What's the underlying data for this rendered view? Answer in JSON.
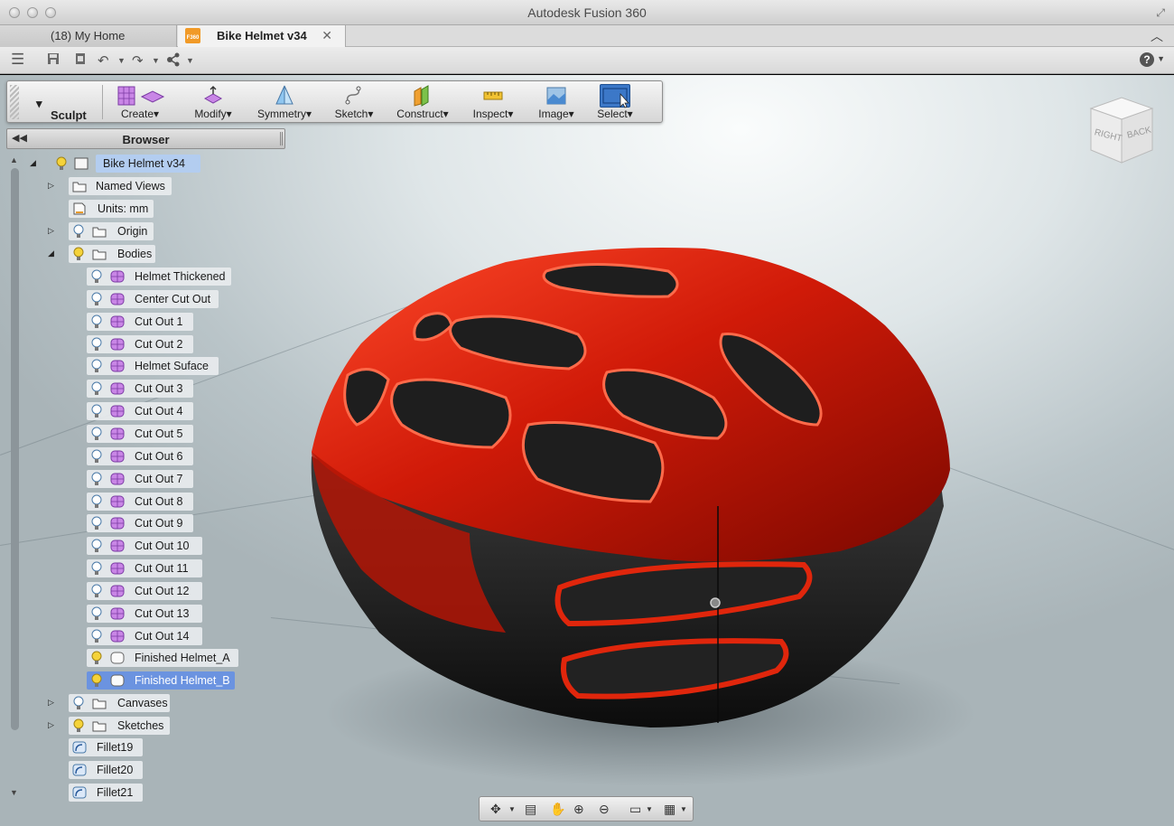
{
  "window": {
    "title": "Autodesk Fusion 360"
  },
  "tabs": [
    {
      "label": "(18) My Home"
    },
    {
      "label": "Bike Helmet v34",
      "icon_text": "F360"
    }
  ],
  "toolbar": {
    "workspace": "Sculpt",
    "tools": [
      {
        "label": "Create",
        "icon": "box-plane-icon"
      },
      {
        "label": "Modify",
        "icon": "modify-icon"
      },
      {
        "label": "Symmetry",
        "icon": "symmetry-icon"
      },
      {
        "label": "Sketch",
        "icon": "sketch-icon"
      },
      {
        "label": "Construct",
        "icon": "construct-icon"
      },
      {
        "label": "Inspect",
        "icon": "ruler-icon"
      },
      {
        "label": "Image",
        "icon": "image-icon"
      },
      {
        "label": "Select",
        "icon": "select-icon",
        "active": true
      }
    ]
  },
  "browser": {
    "title": "Browser",
    "root": "Bike Helmet v34",
    "named_views": "Named Views",
    "units": "Units: mm",
    "origin": "Origin",
    "bodies_folder": "Bodies",
    "bodies": [
      "Helmet Thickened",
      "Center Cut Out",
      "Cut Out 1",
      "Cut Out 2",
      "Helmet Suface",
      "Cut Out 3",
      "Cut Out 4",
      "Cut Out 5",
      "Cut Out 6",
      "Cut Out 7",
      "Cut Out 8",
      "Cut Out 9",
      "Cut Out 10",
      "Cut Out 11",
      "Cut Out 12",
      "Cut Out 13",
      "Cut Out 14"
    ],
    "finished": [
      "Finished Helmet_A",
      "Finished Helmet_B"
    ],
    "canvases": "Canvases",
    "sketches": "Sketches",
    "fillets": [
      "Fillet19",
      "Fillet20",
      "Fillet21"
    ]
  },
  "viewcube": {
    "right": "RIGHT",
    "back": "BACK"
  },
  "colors": {
    "helmet": "#d01a08",
    "helmet_shell": "#1a1a1a",
    "accent": "#3c78c8",
    "folder_bulb": "#f5d33a"
  }
}
